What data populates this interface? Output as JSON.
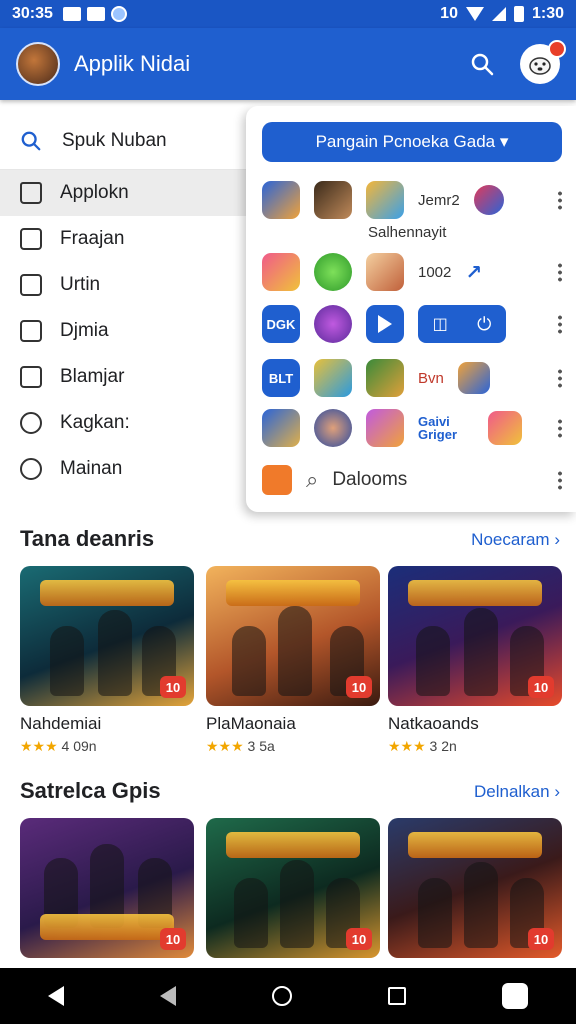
{
  "status_bar": {
    "time": "30:35",
    "right_time": "1:30",
    "right_label": "10"
  },
  "app_bar": {
    "title": "Applik Nidai"
  },
  "drawer": {
    "search_label": "Spuk Nuban",
    "items": [
      {
        "label": "Applokn",
        "icon": "house-icon",
        "active": true
      },
      {
        "label": "Fraajan",
        "icon": "book-icon",
        "active": false
      },
      {
        "label": "Urtin",
        "icon": "document-icon",
        "active": false
      },
      {
        "label": "Djmia",
        "icon": "list-icon",
        "active": false
      },
      {
        "label": "Blamjar",
        "icon": "calendar-icon",
        "active": false
      },
      {
        "label": "Kagkan:",
        "icon": "gamepad-icon",
        "active": false
      },
      {
        "label": "Mainan",
        "icon": "settings-icon",
        "active": false
      }
    ]
  },
  "panel": {
    "button_label": "Pangain Pcnoeka Gada",
    "row1_text": "Jemr2",
    "sublabel": "Salhennayit",
    "row2_text": "1002",
    "row4_text": "Bvn",
    "row3_badge": "DGK",
    "row4_badge": "BLT",
    "row5_text": "Gaivi Griger",
    "footer_text": "Dalooms"
  },
  "section1": {
    "title": "Tana deanris",
    "link": "Noecaram",
    "cards": [
      {
        "name": "Nahdemiai",
        "stars": "★★★",
        "rating": "4 09n",
        "badge": "10",
        "colors": [
          "#1a6b73",
          "#e4a43a"
        ]
      },
      {
        "name": "PlaMaonaia",
        "stars": "★★★",
        "rating": "3 5a",
        "badge": "10",
        "colors": [
          "#b3562a",
          "#f2b35c"
        ]
      },
      {
        "name": "Natkaoands",
        "stars": "★★★",
        "rating": "3 2n",
        "badge": "10",
        "colors": [
          "#1b2e7a",
          "#e84a2a"
        ]
      }
    ]
  },
  "section2": {
    "title": "Satrelca Gpis",
    "link": "Delnalkan",
    "cards": [
      {
        "badge": "10",
        "colors": [
          "#5a2b7a",
          "#e08a3a"
        ]
      },
      {
        "badge": "10",
        "colors": [
          "#1f6a4a",
          "#d9962e"
        ]
      },
      {
        "badge": "10",
        "colors": [
          "#2a3b6a",
          "#e45a2a"
        ]
      }
    ]
  }
}
